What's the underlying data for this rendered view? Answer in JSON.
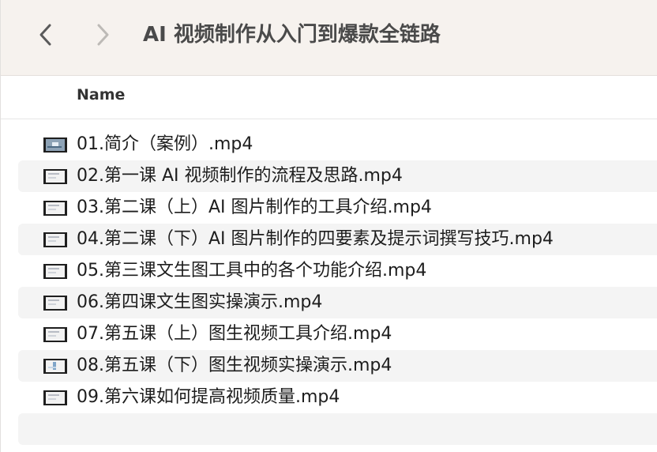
{
  "toolbar": {
    "title": "AI 视频制作从入门到爆款全链路",
    "back_icon": "chevron-left-icon",
    "forward_icon": "chevron-right-icon"
  },
  "list_header": {
    "name_label": "Name"
  },
  "files": [
    {
      "name": "01.简介（案例）.mp4",
      "thumb": "video"
    },
    {
      "name": "02.第一课 AI 视频制作的流程及思路.mp4",
      "thumb": "doc"
    },
    {
      "name": "03.第二课（上）AI 图片制作的工具介绍.mp4",
      "thumb": "doc"
    },
    {
      "name": "04.第二课（下）AI 图片制作的四要素及提示词撰写技巧.mp4",
      "thumb": "doc"
    },
    {
      "name": "05.第三课文生图工具中的各个功能介绍.mp4",
      "thumb": "doc"
    },
    {
      "name": "06.第四课文生图实操演示.mp4",
      "thumb": "doc"
    },
    {
      "name": "07.第五课（上）图生视频工具介绍.mp4",
      "thumb": "doc"
    },
    {
      "name": "08.第五课（下）图生视频实操演示.mp4",
      "thumb": "blue"
    },
    {
      "name": "09.第六课如何提高视频质量.mp4",
      "thumb": "doc"
    }
  ],
  "colors": {
    "toolbar_bg": "#f6f2ee",
    "row_alt_bg": "#f4f4f4",
    "title_text": "#4a4a4a"
  }
}
